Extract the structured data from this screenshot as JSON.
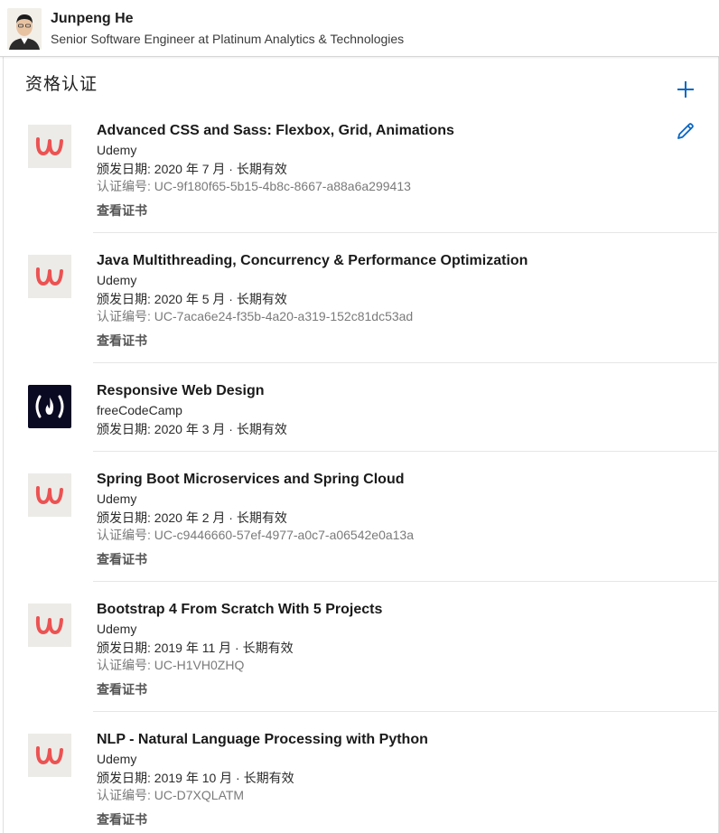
{
  "profile": {
    "name": "Junpeng He",
    "headline": "Senior Software Engineer at Platinum Analytics & Technologies"
  },
  "section": {
    "title": "资格认证",
    "add_icon": "plus-icon",
    "edit_icon": "pencil-icon"
  },
  "colors": {
    "accent": "#0a66c2",
    "udemy_red": "#ec5252",
    "fcc_bg": "#0a0a23"
  },
  "certifications": [
    {
      "title": "Advanced CSS and Sass: Flexbox, Grid, Animations",
      "issuer": "Udemy",
      "issued": "颁发日期: 2020 年 7 月 · 长期有效",
      "credential": "认证编号: UC-9f180f65-5b15-4b8c-8667-a88a6a299413",
      "view": "查看证书",
      "logo": "udemy-logo"
    },
    {
      "title": "Java Multithreading, Concurrency & Performance Optimization",
      "issuer": "Udemy",
      "issued": "颁发日期: 2020 年 5 月 · 长期有效",
      "credential": "认证编号: UC-7aca6e24-f35b-4a20-a319-152c81dc53ad",
      "view": "查看证书",
      "logo": "udemy-logo"
    },
    {
      "title": "Responsive Web Design",
      "issuer": "freeCodeCamp",
      "issued": "颁发日期: 2020 年 3 月 · 长期有效",
      "logo": "freecodecamp-logo"
    },
    {
      "title": "Spring Boot Microservices and Spring Cloud",
      "issuer": "Udemy",
      "issued": "颁发日期: 2020 年 2 月 · 长期有效",
      "credential": "认证编号: UC-c9446660-57ef-4977-a0c7-a06542e0a13a",
      "view": "查看证书",
      "logo": "udemy-logo"
    },
    {
      "title": "Bootstrap 4 From Scratch With 5 Projects",
      "issuer": "Udemy",
      "issued": "颁发日期: 2019 年 11 月 · 长期有效",
      "credential": "认证编号: UC-H1VH0ZHQ",
      "view": "查看证书",
      "logo": "udemy-logo"
    },
    {
      "title": "NLP - Natural Language Processing with Python",
      "issuer": "Udemy",
      "issued": "颁发日期: 2019 年 10 月 · 长期有效",
      "credential": "认证编号: UC-D7XQLATM",
      "view": "查看证书",
      "logo": "udemy-logo"
    }
  ]
}
